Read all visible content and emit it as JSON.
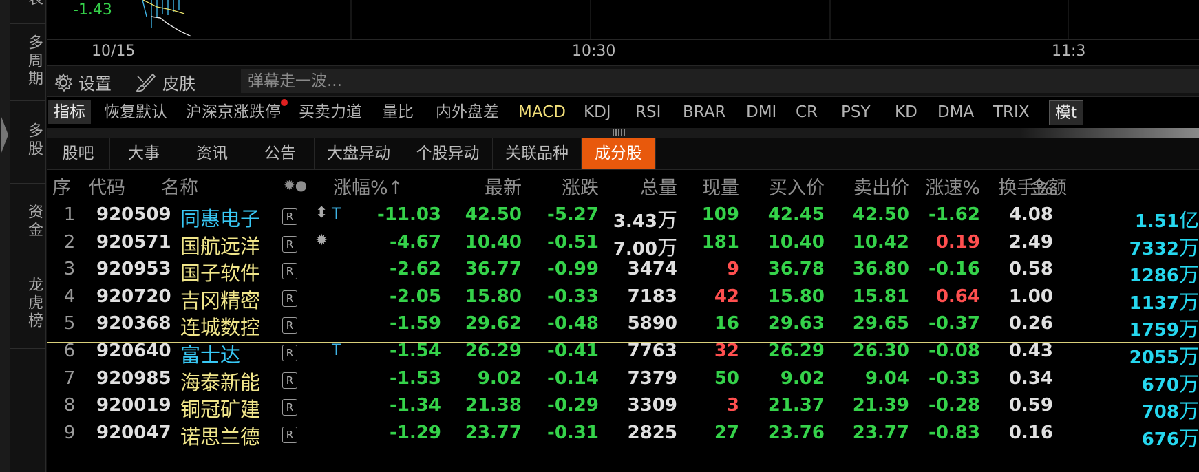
{
  "leftnav": {
    "items": [
      {
        "label": "表"
      },
      {
        "label": "多周期"
      },
      {
        "label": "多股"
      },
      {
        "label": "资金"
      },
      {
        "label": "龙虎榜"
      }
    ]
  },
  "chart": {
    "y_value": "-1.43",
    "time_labels": [
      "10/15",
      "10:30",
      "11:3"
    ]
  },
  "toolbar": {
    "settings_label": "设置",
    "skin_label": "皮肤",
    "danmaku_placeholder": "弹幕走一波..."
  },
  "indicators": {
    "tabs": [
      "指标",
      "恢复默认",
      "沪深京涨跌停",
      "买卖力道",
      "量比",
      "内外盘差",
      "MACD",
      "KDJ",
      "RSI",
      "BRAR",
      "DMI",
      "CR",
      "PSY",
      "KD",
      "DMA",
      "TRIX"
    ],
    "template_button": "模t",
    "active": "指标",
    "highlight": "MACD",
    "notification_dot_on": "沪深京涨跌停"
  },
  "subtabs": {
    "items": [
      "股吧",
      "大事",
      "资讯",
      "公告",
      "大盘异动",
      "个股异动",
      "关联品种",
      "成分股"
    ],
    "active": "成分股"
  },
  "table": {
    "headers": {
      "idx": "序",
      "code": "代码",
      "name": "名称",
      "flag": "✹●",
      "chg": "涨幅%↑",
      "last": "最新",
      "diff": "涨跌",
      "vol": "总量",
      "now": "现量",
      "bid": "买入价",
      "ask": "卖出价",
      "spd": "涨速%",
      "tov": "换手%",
      "amt": "金额"
    },
    "rows": [
      {
        "idx": "1",
        "code": "920509",
        "name": "同惠电子",
        "name_color": "cyan",
        "r": "R",
        "flag": "⬍",
        "t": "T",
        "chg": "-11.03",
        "last": "42.50",
        "diff": "-5.27",
        "vol": "3.43",
        "vol_unit": "万",
        "now": "109",
        "now_color": "green",
        "bid": "42.45",
        "ask": "42.50",
        "spd": "-1.62",
        "spd_color": "green",
        "tov": "4.08",
        "amt": "1.51",
        "amt_unit": "亿"
      },
      {
        "idx": "2",
        "code": "920571",
        "name": "国航远洋",
        "name_color": "yellow",
        "r": "R",
        "flag": "✹",
        "t": "",
        "chg": "-4.67",
        "last": "10.40",
        "diff": "-0.51",
        "vol": "7.00",
        "vol_unit": "万",
        "now": "181",
        "now_color": "green",
        "bid": "10.40",
        "ask": "10.42",
        "spd": "0.19",
        "spd_color": "red",
        "tov": "2.49",
        "amt": "7332",
        "amt_unit": "万"
      },
      {
        "idx": "3",
        "code": "920953",
        "name": "国子软件",
        "name_color": "yellow",
        "r": "R",
        "flag": "",
        "t": "",
        "chg": "-2.62",
        "last": "36.77",
        "diff": "-0.99",
        "vol": "3474",
        "vol_unit": "",
        "now": "9",
        "now_color": "red",
        "bid": "36.78",
        "ask": "36.80",
        "spd": "-0.16",
        "spd_color": "green",
        "tov": "0.58",
        "amt": "1286",
        "amt_unit": "万"
      },
      {
        "idx": "4",
        "code": "920720",
        "name": "吉冈精密",
        "name_color": "yellow",
        "r": "R",
        "flag": "",
        "t": "",
        "chg": "-2.05",
        "last": "15.80",
        "diff": "-0.33",
        "vol": "7183",
        "vol_unit": "",
        "now": "42",
        "now_color": "red",
        "bid": "15.80",
        "ask": "15.81",
        "spd": "0.64",
        "spd_color": "red",
        "tov": "1.00",
        "amt": "1137",
        "amt_unit": "万"
      },
      {
        "idx": "5",
        "code": "920368",
        "name": "连城数控",
        "name_color": "yellow",
        "r": "R",
        "flag": "",
        "t": "",
        "chg": "-1.59",
        "last": "29.62",
        "diff": "-0.48",
        "vol": "5890",
        "vol_unit": "",
        "now": "16",
        "now_color": "green",
        "bid": "29.63",
        "ask": "29.65",
        "spd": "-0.37",
        "spd_color": "green",
        "tov": "0.26",
        "amt": "1759",
        "amt_unit": "万"
      },
      {
        "idx": "6",
        "code": "920640",
        "name": "富士达",
        "name_color": "cyan",
        "r": "R",
        "flag": "",
        "t": "T",
        "chg": "-1.54",
        "last": "26.29",
        "diff": "-0.41",
        "vol": "7763",
        "vol_unit": "",
        "now": "32",
        "now_color": "red",
        "bid": "26.29",
        "ask": "26.30",
        "spd": "-0.08",
        "spd_color": "green",
        "tov": "0.43",
        "amt": "2055",
        "amt_unit": "万"
      },
      {
        "idx": "7",
        "code": "920985",
        "name": "海泰新能",
        "name_color": "yellow",
        "r": "R",
        "flag": "",
        "t": "",
        "chg": "-1.53",
        "last": "9.02",
        "diff": "-0.14",
        "vol": "7379",
        "vol_unit": "",
        "now": "50",
        "now_color": "green",
        "bid": "9.02",
        "ask": "9.04",
        "spd": "-0.33",
        "spd_color": "green",
        "tov": "0.34",
        "amt": "670",
        "amt_unit": "万"
      },
      {
        "idx": "8",
        "code": "920019",
        "name": "铜冠矿建",
        "name_color": "yellow",
        "r": "R",
        "flag": "",
        "t": "",
        "chg": "-1.34",
        "last": "21.38",
        "diff": "-0.29",
        "vol": "3309",
        "vol_unit": "",
        "now": "3",
        "now_color": "red",
        "bid": "21.37",
        "ask": "21.39",
        "spd": "-0.28",
        "spd_color": "green",
        "tov": "0.59",
        "amt": "708",
        "amt_unit": "万"
      },
      {
        "idx": "9",
        "code": "920047",
        "name": "诺思兰德",
        "name_color": "yellow",
        "r": "R",
        "flag": "",
        "t": "",
        "chg": "-1.29",
        "last": "23.77",
        "diff": "-0.31",
        "vol": "2825",
        "vol_unit": "",
        "now": "27",
        "now_color": "green",
        "bid": "23.76",
        "ask": "23.77",
        "spd": "-0.83",
        "spd_color": "green",
        "tov": "0.16",
        "amt": "676",
        "amt_unit": "万"
      }
    ]
  }
}
